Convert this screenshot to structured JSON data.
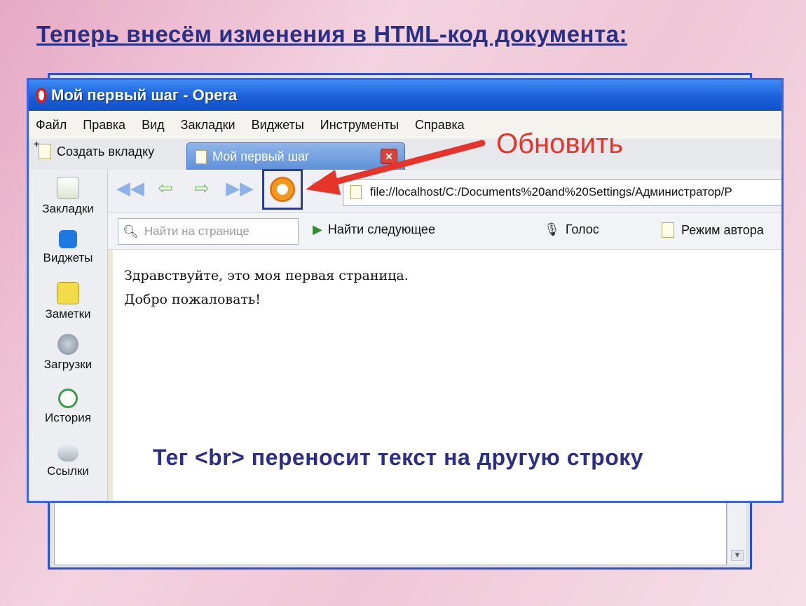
{
  "slide": {
    "title": "Теперь внесём изменения в HTML-код документа:",
    "caption": "Тег <br> переносит текст на другую строку"
  },
  "annotation": {
    "label": "Обновить",
    "color": "#e5342a"
  },
  "window": {
    "title": "Мой первый шаг - Opera",
    "menu": [
      "Файл",
      "Правка",
      "Вид",
      "Закладки",
      "Виджеты",
      "Инструменты",
      "Справка"
    ],
    "new_tab_label": "Создать вкладку",
    "active_tab_label": "Мой первый шаг",
    "address": "file://localhost/C:/Documents%20and%20Settings/Администратор/P",
    "find_placeholder": "Найти на странице",
    "find_next": "Найти следующее",
    "voice": "Голос",
    "author_mode": "Режим автора"
  },
  "sidebar": {
    "items": [
      "Закладки",
      "Виджеты",
      "Заметки",
      "Загрузки",
      "История",
      "Ссылки"
    ]
  },
  "page": {
    "lines": [
      "Здравствуйте, это моя первая страница.",
      "Добро пожаловать!"
    ]
  },
  "icons": {
    "back_all": "rewind-icon",
    "back": "back-icon",
    "forward": "forward-icon",
    "forward_all": "fast-forward-icon",
    "reload": "reload-icon"
  }
}
